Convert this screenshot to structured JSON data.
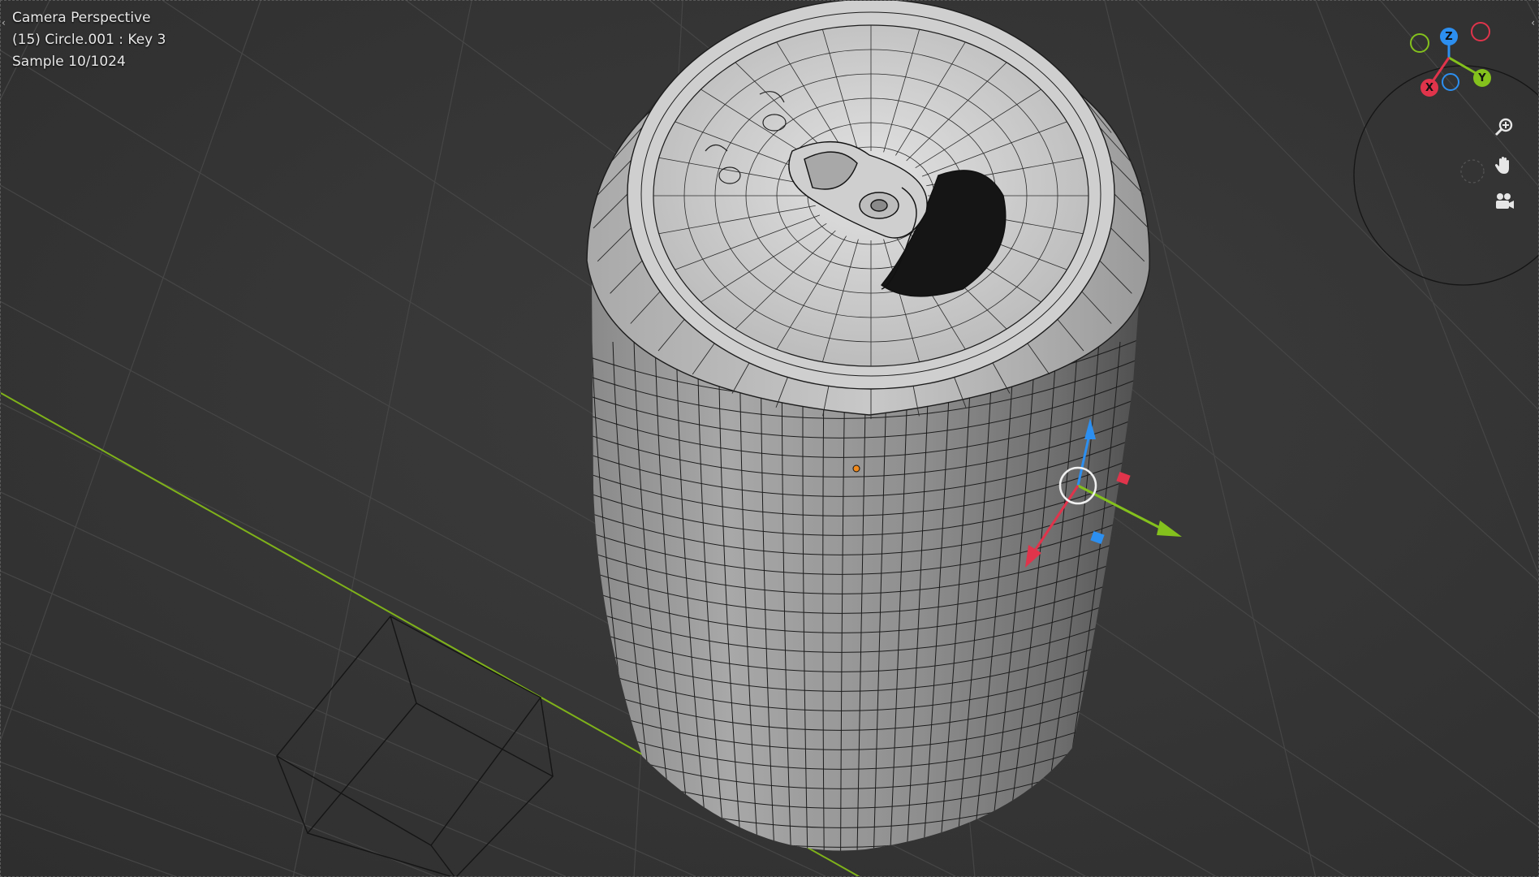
{
  "viewport": {
    "overlay": {
      "view_name": "Camera Perspective",
      "object_info": "(15) Circle.001 : Key 3",
      "sample": "Sample 10/1024"
    }
  },
  "gizmo": {
    "axes": {
      "x": "X",
      "y": "Y",
      "z": "Z"
    },
    "colors": {
      "x": "#e0344b",
      "y": "#84c11d",
      "z": "#2c8ff0",
      "x_neg": "#8a2632",
      "y_neg": "#4f7d17",
      "z_neg": "#1d5a96"
    },
    "buttons": [
      "zoom-icon",
      "hand-pan-icon",
      "camera-view-icon"
    ]
  },
  "colors": {
    "grid": "#474747",
    "y_axis_line": "#7fb21a",
    "can_light": "#d6d6d6",
    "can_dark": "#5a5a5a",
    "wire": "#1a1a1a"
  }
}
